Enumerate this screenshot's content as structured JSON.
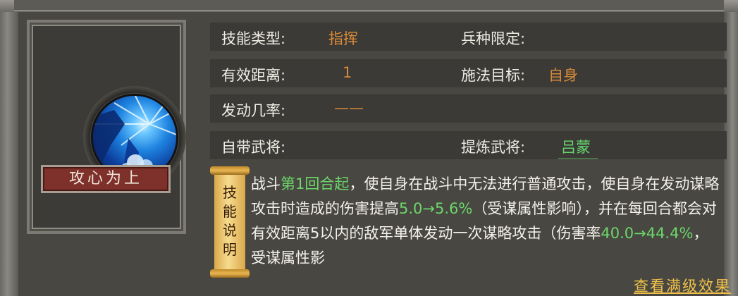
{
  "skill": {
    "name": "攻心为上"
  },
  "info": {
    "type_label": "技能类型:",
    "type_value": "指挥",
    "troop_label": "兵种限定:",
    "range_label": "有效距离:",
    "range_value": "1",
    "target_label": "施法目标:",
    "target_value": "自身",
    "chance_label": "发动几率:",
    "chance_value": "——",
    "own_general_label": "自带武将:",
    "refine_label": "提炼武将:",
    "refine_value": "吕蒙"
  },
  "scroll": {
    "text": "技能说明"
  },
  "description": {
    "p1": "战斗",
    "p2": "第1回合起",
    "p3": "，使自身在战斗中无法进行普通攻击，使自身在发动谋略攻击时造成的伤害提高",
    "p4": "5.0→5.6%",
    "p5": "（受谋属性影响），并在每回合都会对有效距离5以内的敌军单体发动一次谋略攻击（伤害率",
    "p6": "40.0→44.4%",
    "p7": "，受谋属性影"
  },
  "actions": {
    "view_full": "查看满级效果"
  },
  "colors": {
    "accent_orange": "#d88b3a",
    "accent_green": "#65d46c",
    "link_gold": "#f0c14a",
    "name_plate": "#7e312b"
  }
}
